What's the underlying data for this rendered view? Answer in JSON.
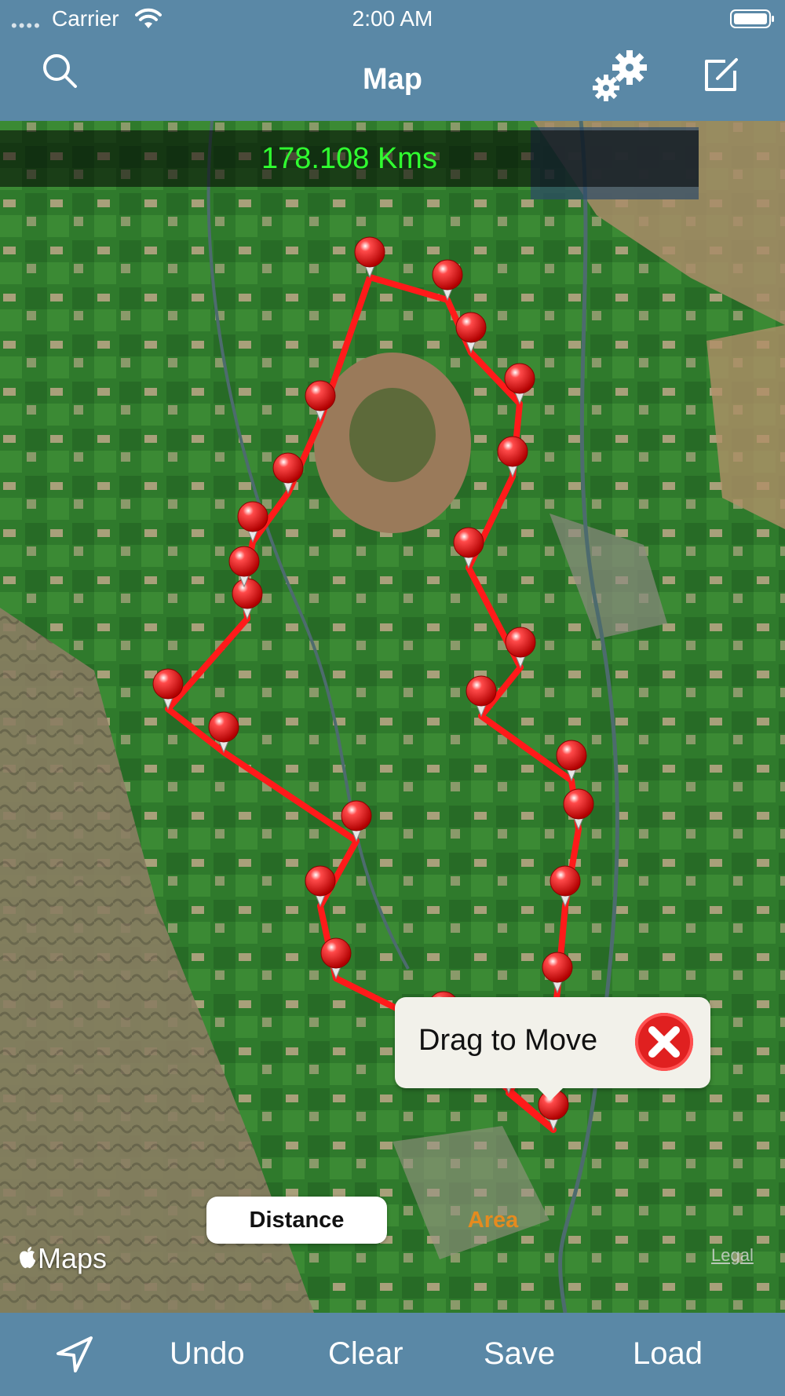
{
  "status": {
    "carrier": "Carrier",
    "time": "2:00 AM"
  },
  "nav": {
    "title": "Map",
    "icons": [
      "search-icon",
      "settings-gears-icon",
      "compose-icon"
    ]
  },
  "map": {
    "distance": "178.108 Kms",
    "callout": "Drag to Move",
    "mode_distance": "Distance",
    "mode_area": "Area",
    "maps_label": "Maps",
    "legal": "Legal",
    "route_color": "#ff1a1a",
    "pin_count": 25
  },
  "toolbar": {
    "undo": "Undo",
    "clear": "Clear",
    "save": "Save",
    "load": "Load",
    "location_icon": "location-arrow-icon"
  }
}
